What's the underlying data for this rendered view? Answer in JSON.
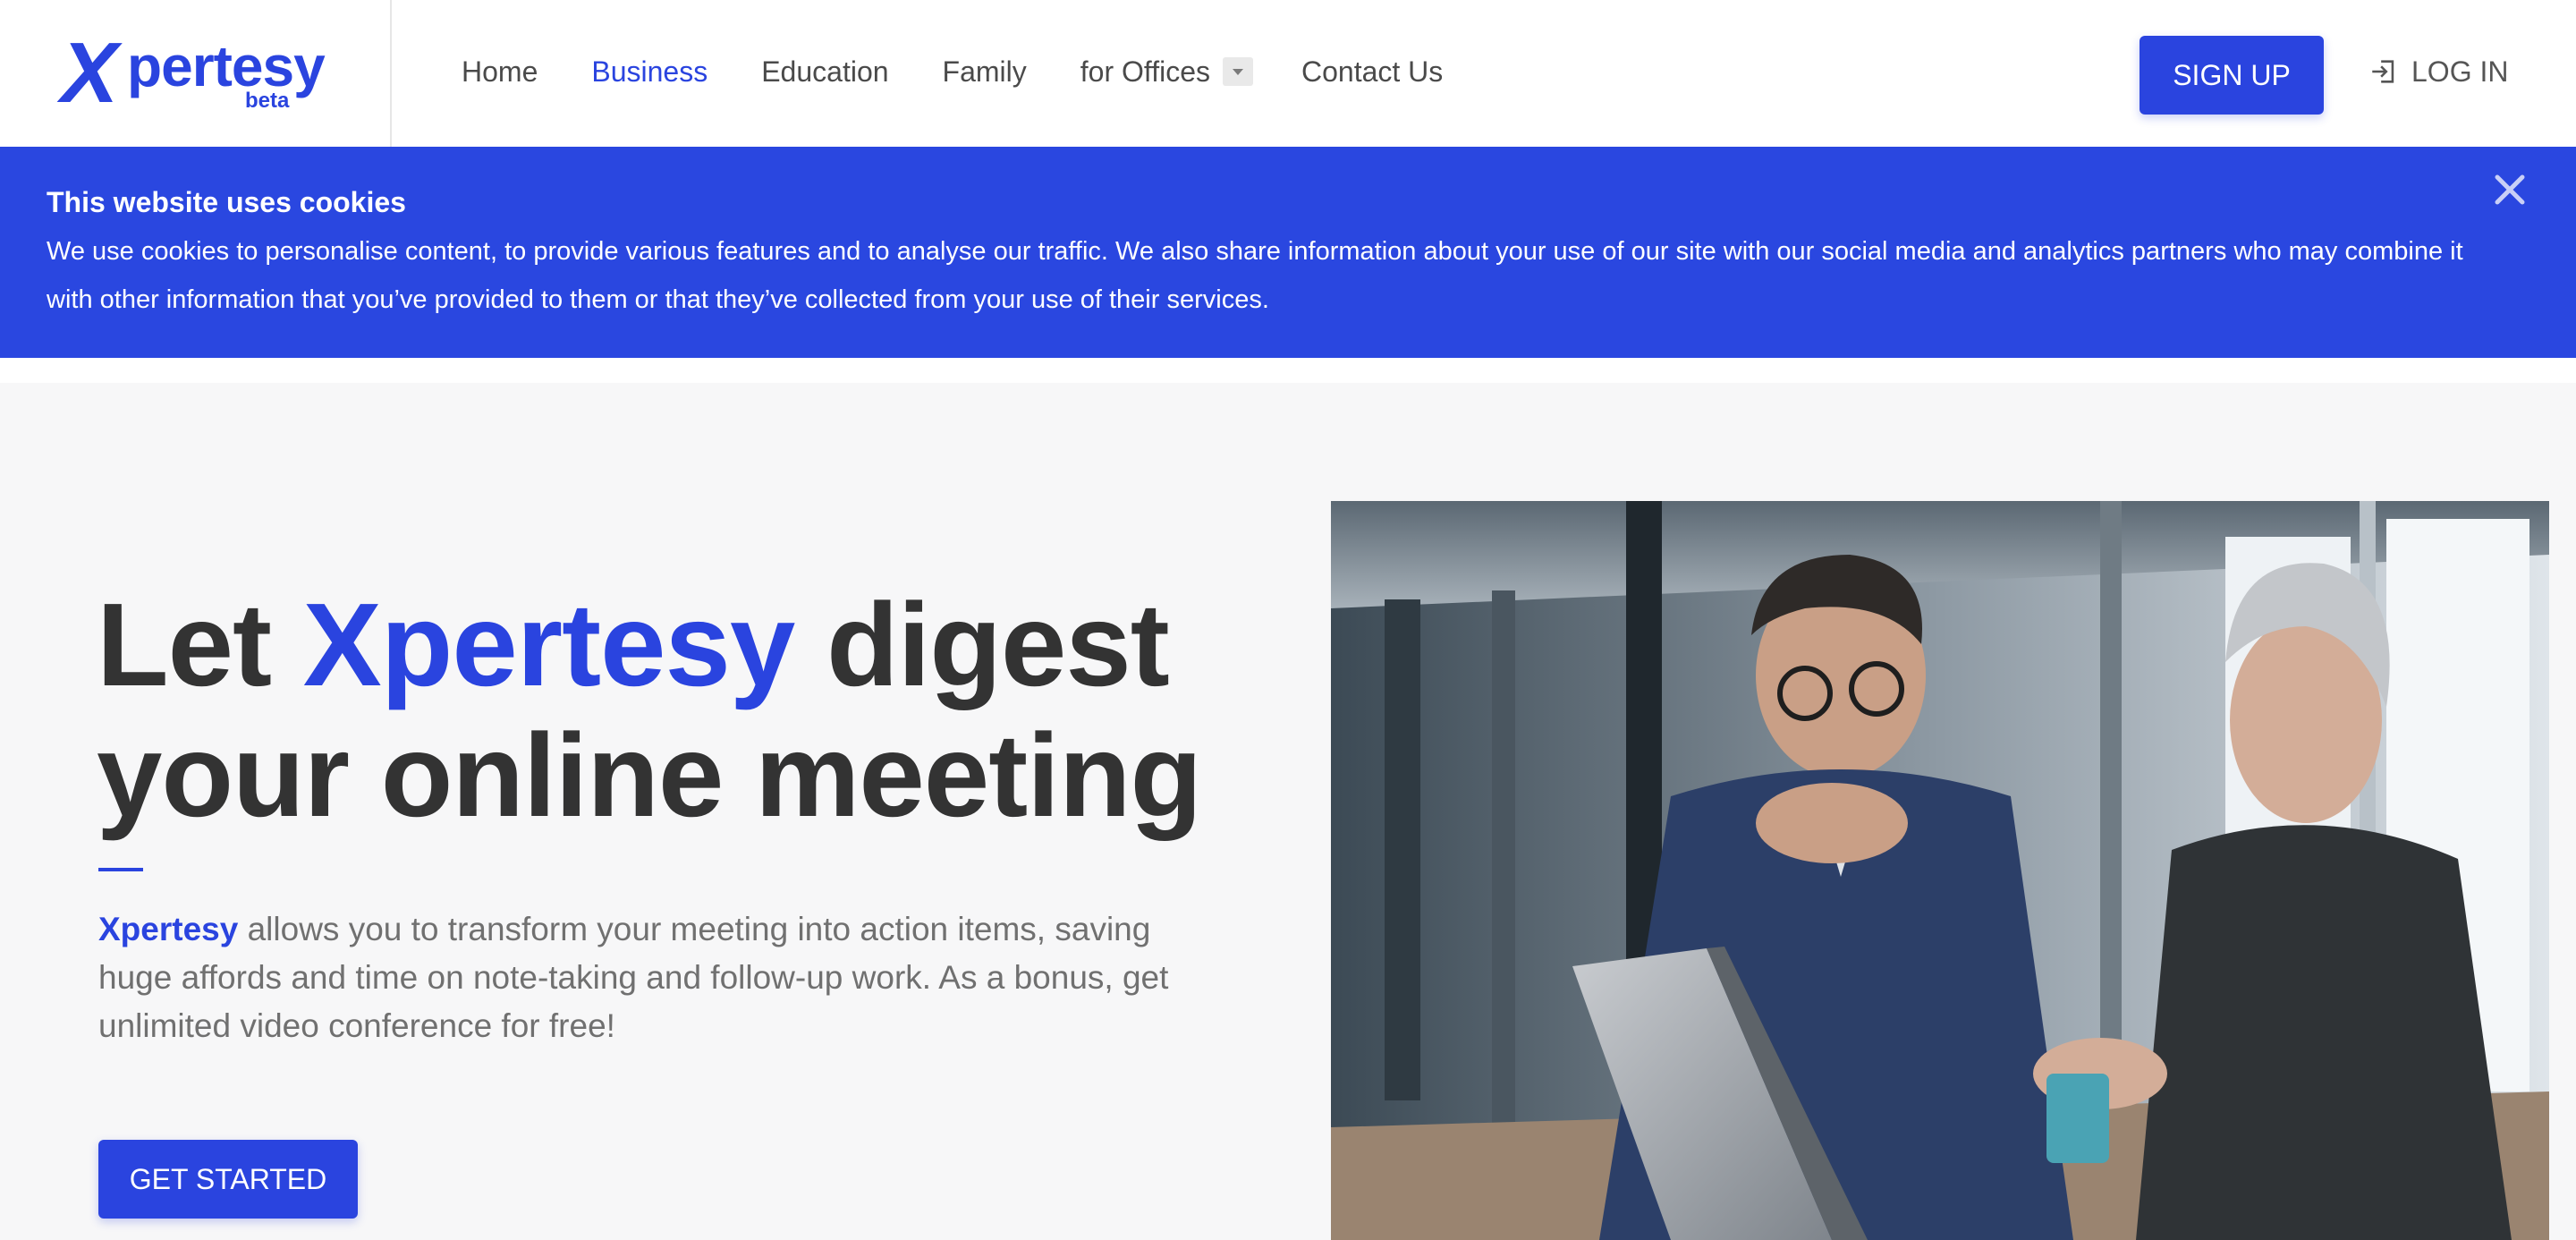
{
  "brand": {
    "logo_initial": "X",
    "logo_rest": "pertesy",
    "logo_tag": "beta",
    "accent_color": "#2a44df"
  },
  "nav": {
    "links": [
      "Home",
      "Business",
      "Education",
      "Family",
      "for Offices",
      "Contact Us"
    ],
    "active": "Business",
    "signup_label": "SIGN UP",
    "login_label": "LOG IN"
  },
  "cookie_banner": {
    "title": "This website uses cookies",
    "text": "We use cookies to personalise content, to provide various features and to analyse our traffic. We also share information about your use of our site with our social media and analytics partners who may combine it with other information that you’ve provided to them or that they’ve collected from your use of their services.",
    "background_color": "#2a47e0"
  },
  "hero": {
    "title_prefix": "Let ",
    "title_brand": "Xpertesy",
    "title_suffix": " digest your online meeting",
    "desc_brand": "Xpertesy",
    "desc_text": " allows you to transform your meeting into action items, saving huge affords and time on note-taking and follow-up work. As a bonus, get unlimited video conference for free!",
    "cta_label": "GET STARTED"
  },
  "photo": {
    "icon": "business-meeting-photo"
  }
}
